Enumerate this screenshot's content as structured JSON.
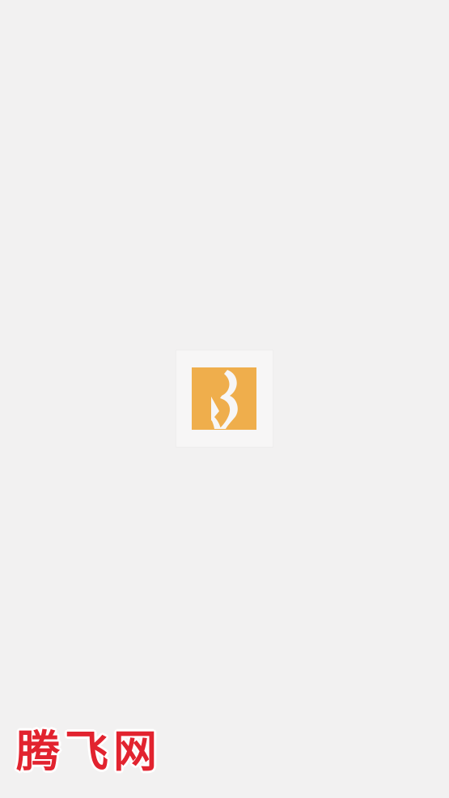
{
  "screen": {
    "name": "app-splash-screen",
    "background_color": "#f2f1f1"
  },
  "logo": {
    "icon": "brand-b-logo-icon",
    "color": "#efae4c",
    "tile_color": "#f7f6f6"
  },
  "watermark": {
    "text": "腾飞网",
    "color": "#e2232f"
  }
}
